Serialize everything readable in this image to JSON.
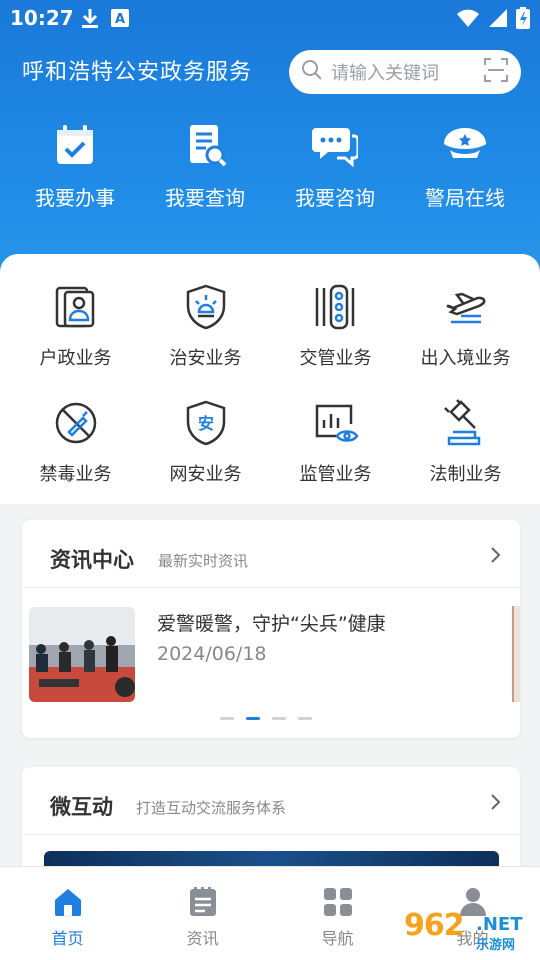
{
  "status_bar": {
    "time": "10:27",
    "left_icons": [
      "download-icon",
      "a-notification-icon"
    ],
    "right_icons": [
      "wifi-icon",
      "signal-icon",
      "battery-charging-icon"
    ]
  },
  "header": {
    "title": "呼和浩特公安政务服务",
    "search_placeholder": "请输入关键词",
    "accent_color": "#1f7ee0"
  },
  "quick_actions": [
    {
      "label": "我要办事",
      "icon": "calendar-check-icon"
    },
    {
      "label": "我要查询",
      "icon": "document-search-icon"
    },
    {
      "label": "我要咨询",
      "icon": "chat-bubbles-icon"
    },
    {
      "label": "警局在线",
      "icon": "police-cap-icon"
    }
  ],
  "services": [
    {
      "label": "户政业务",
      "icon": "id-card-icon"
    },
    {
      "label": "治安业务",
      "icon": "shield-light-icon"
    },
    {
      "label": "交管业务",
      "icon": "traffic-light-icon"
    },
    {
      "label": "出入境业务",
      "icon": "airplane-icon"
    },
    {
      "label": "禁毒业务",
      "icon": "no-drugs-icon"
    },
    {
      "label": "网安业务",
      "icon": "shield-an-icon"
    },
    {
      "label": "监管业务",
      "icon": "monitor-eye-icon"
    },
    {
      "label": "法制业务",
      "icon": "gavel-icon"
    }
  ],
  "news": {
    "title": "资讯中心",
    "subtitle": "最新实时资讯",
    "item": {
      "title": "爱警暖警，守护“尖兵”健康",
      "date": "2024/06/18"
    },
    "carousel_total": 4,
    "carousel_active": 2
  },
  "interact": {
    "title": "微互动",
    "subtitle": "打造互动交流服务体系"
  },
  "tabs": [
    {
      "label": "首页",
      "icon": "home-icon",
      "active": true
    },
    {
      "label": "资讯",
      "icon": "news-icon",
      "active": false
    },
    {
      "label": "导航",
      "icon": "grid-icon",
      "active": false
    },
    {
      "label": "我的",
      "icon": "profile-icon",
      "active": false
    }
  ],
  "watermark": {
    "number": "962",
    "suffix": ".NET",
    "text": "乐游网"
  }
}
